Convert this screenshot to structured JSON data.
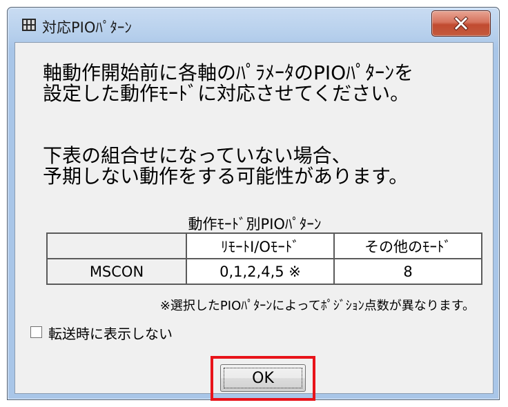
{
  "window": {
    "title": "対応PIOﾊﾟﾀｰﾝ",
    "close_glyph": "✕"
  },
  "message": {
    "line1": "軸動作開始前に各軸のﾊﾟﾗﾒｰﾀのPIOﾊﾟﾀｰﾝを",
    "line2": "設定した動作ﾓｰﾄﾞに対応させてください。",
    "line3": "下表の組合せになっていない場合、",
    "line4": "予期しない動作をする可能性があります。"
  },
  "table": {
    "caption": "動作ﾓｰﾄﾞ別PIOﾊﾟﾀｰﾝ",
    "headers": [
      "",
      "ﾘﾓｰﾄI/Oﾓｰﾄﾞ",
      "その他のﾓｰﾄﾞ"
    ],
    "rows": [
      {
        "name": "MSCON",
        "remote_io": "0,1,2,4,5 ※",
        "other": "8"
      }
    ]
  },
  "note": "※選択したPIOﾊﾟﾀｰﾝによってﾎﾟｼﾞｼｮﾝ点数が異なります。",
  "checkbox": {
    "label": "転送時に表示しない",
    "checked": false
  },
  "ok_button": {
    "label": "OK"
  },
  "colors": {
    "highlight": "#e8131a",
    "close_button": "#c14a30"
  },
  "icons": [
    "app-icon",
    "close-icon"
  ]
}
